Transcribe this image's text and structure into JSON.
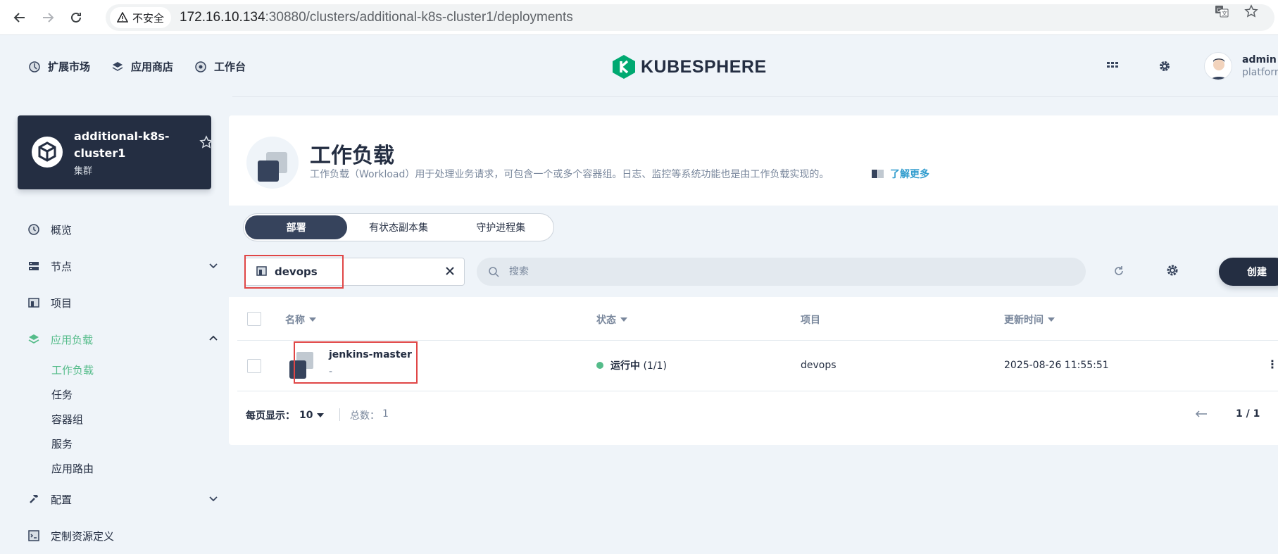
{
  "browser": {
    "insecure_label": "不安全",
    "url_host": "172.16.10.134",
    "url_rest": ":30880/clusters/additional-k8s-cluster1/deployments"
  },
  "topnav": {
    "items": [
      {
        "label": "扩展市场",
        "icon": "extensions-icon"
      },
      {
        "label": "应用商店",
        "icon": "app-store-icon"
      },
      {
        "label": "工作台",
        "icon": "workbench-icon"
      }
    ],
    "logo_text": "KUBESPHERE",
    "user": {
      "name": "admin",
      "role": "platform"
    }
  },
  "cluster": {
    "name": "additional-k8s-cluster1",
    "type": "集群"
  },
  "sidebar": {
    "items": [
      {
        "label": "概览"
      },
      {
        "label": "节点"
      },
      {
        "label": "项目"
      },
      {
        "label": "应用负载"
      },
      {
        "label": "配置"
      },
      {
        "label": "定制资源定义"
      }
    ],
    "submenu": [
      "工作负载",
      "任务",
      "容器组",
      "服务",
      "应用路由"
    ]
  },
  "page": {
    "title": "工作负载",
    "description": "工作负载（Workload）用于处理业务请求，可包含一个或多个容器组。日志、监控等系统功能也是由工作负载实现的。",
    "learn_more": "了解更多",
    "tabs": [
      "部署",
      "有状态副本集",
      "守护进程集"
    ]
  },
  "toolbar": {
    "namespace": "devops",
    "search_placeholder": "搜索",
    "create_label": "创建"
  },
  "table": {
    "columns": {
      "name": "名称",
      "status": "状态",
      "project": "项目",
      "updated": "更新时间"
    },
    "rows": [
      {
        "name": "jenkins-master",
        "desc": "-",
        "status": "运行中",
        "replicas": "(1/1)",
        "project": "devops",
        "updated": "2025-08-26 11:55:51"
      }
    ]
  },
  "pager": {
    "per_page_label": "每页显示：",
    "per_page_value": "10",
    "total_label": "总数：",
    "total_value": "1",
    "page": "1 / 1"
  },
  "colors": {
    "accent": "#55bc8a",
    "dark": "#242e42",
    "link": "#329dce",
    "highlight": "#e04646"
  }
}
